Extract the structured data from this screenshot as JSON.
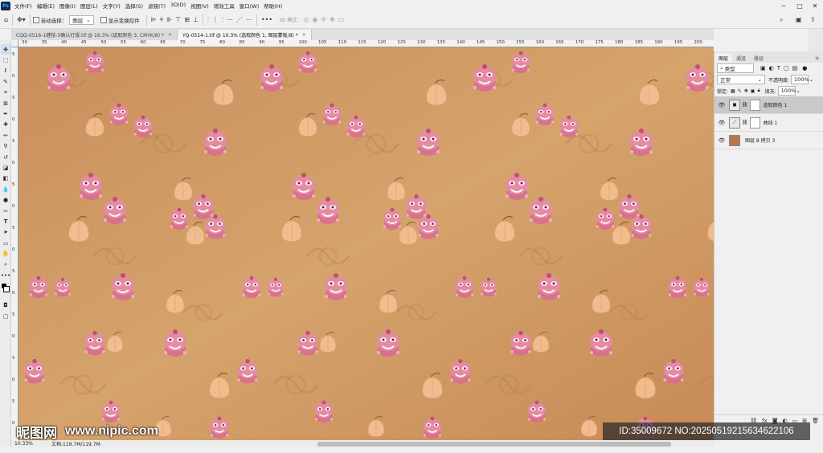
{
  "menubar": {
    "logo": "Ps",
    "items": [
      "文件(F)",
      "编辑(E)",
      "图像(I)",
      "图层(L)",
      "文字(Y)",
      "选择(S)",
      "滤镜(T)",
      "3D(D)",
      "视图(V)",
      "增效工具",
      "窗口(W)",
      "帮助(H)"
    ]
  },
  "options": {
    "auto_select_label": "自动选择：",
    "auto_select_value": "图层",
    "show_transform_label": "显示变换控件",
    "mode_3d_label": "3D 模式："
  },
  "tabs": [
    {
      "label": "CQQ-0516-1缠枝-3确认打版.tif @ 16.3% (选取颜色 3, CMYK/8) *",
      "active": false
    },
    {
      "label": "YQ-0514-1.tif @ 10.3% (选取颜色 1, 图层蒙板/8) *",
      "active": true
    }
  ],
  "rulers": {
    "h_ticks": [
      "30",
      "35",
      "40",
      "45",
      "50",
      "55",
      "60",
      "65",
      "70",
      "75",
      "80",
      "85",
      "90",
      "95",
      "100",
      "105",
      "110",
      "115",
      "120",
      "125",
      "130",
      "135",
      "140",
      "145",
      "150",
      "155",
      "160",
      "165",
      "170",
      "175",
      "180",
      "185",
      "190",
      "195",
      "200"
    ],
    "v_ticks": [
      "5",
      "0",
      "5",
      "0",
      "5",
      "0",
      "5",
      "0",
      "5",
      "0",
      "5",
      "0",
      "5",
      "0",
      "5",
      "0",
      "5",
      "0"
    ]
  },
  "status": {
    "zoom": "10.33%",
    "doc": "文档:119.7M/119.7M"
  },
  "layers_panel": {
    "tabs": [
      "图层",
      "通道",
      "路径"
    ],
    "filter_kind": "类型",
    "blend_mode": "正常",
    "opacity_label": "不透明度:",
    "opacity_value": "100%",
    "lock_label": "锁定:",
    "fill_label": "填充:",
    "fill_value": "100%",
    "layers": [
      {
        "name": "选取颜色 1",
        "active": true,
        "kind": "adjust"
      },
      {
        "name": "曲线 1",
        "active": false,
        "kind": "curves"
      },
      {
        "name": "图层 8 拷贝 3",
        "active": false,
        "kind": "image"
      }
    ]
  },
  "watermark": {
    "logo_text": "昵图网",
    "url": "www.nipic.com",
    "id_text": "ID:35009672 NO:20250519215634622106"
  },
  "colors": {
    "canvas_base": "#cf9a63",
    "lion_pink": "#e07a9a",
    "fruit_peach": "#f0b88a"
  }
}
